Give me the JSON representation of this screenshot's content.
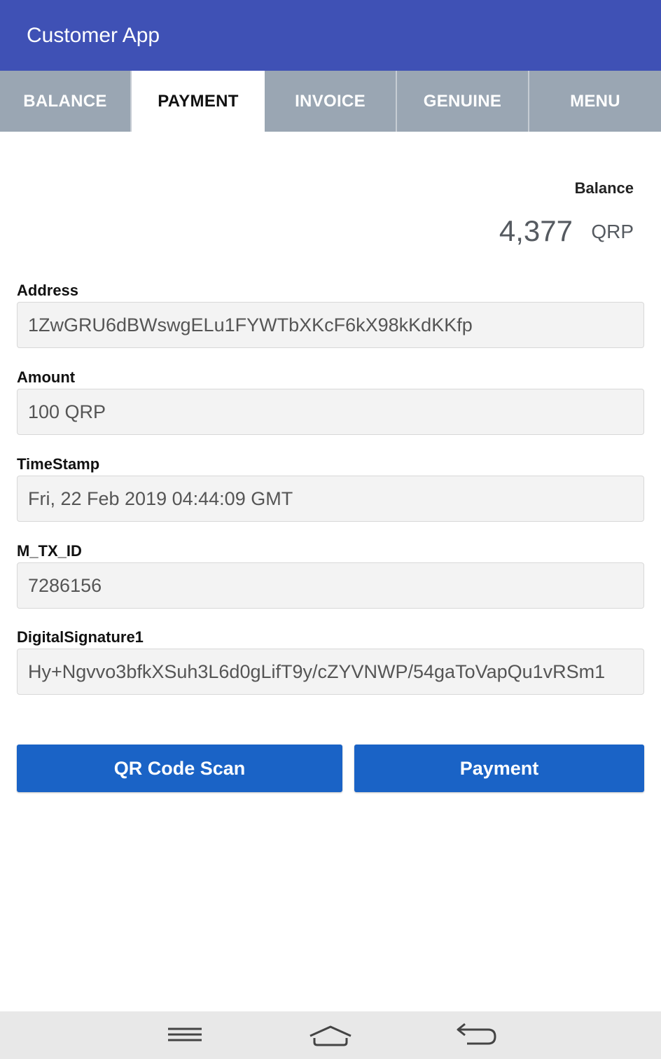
{
  "app": {
    "title": "Customer App"
  },
  "tabs": [
    {
      "label": "BALANCE",
      "active": false
    },
    {
      "label": "PAYMENT",
      "active": true
    },
    {
      "label": "INVOICE",
      "active": false
    },
    {
      "label": "GENUINE",
      "active": false
    },
    {
      "label": "MENU",
      "active": false
    }
  ],
  "balance": {
    "label": "Balance",
    "value": "4,377",
    "unit": "QRP"
  },
  "fields": {
    "address": {
      "label": "Address",
      "value": "1ZwGRU6dBWswgELu1FYWTbXKcF6kX98kKdKKfp"
    },
    "amount": {
      "label": "Amount",
      "value": "100 QRP"
    },
    "timestamp": {
      "label": "TimeStamp",
      "value": "Fri, 22 Feb 2019 04:44:09 GMT"
    },
    "m_tx_id": {
      "label": "M_TX_ID",
      "value": "7286156"
    },
    "signature": {
      "label": "DigitalSignature1",
      "value": "Hy+Ngvvo3bfkXSuh3L6d0gLifT9y/cZYVNWP/54gaToVapQu1vRSm1"
    }
  },
  "actions": {
    "scan_label": "QR Code Scan",
    "payment_label": "Payment"
  },
  "nav": {
    "icons": [
      "menu-icon",
      "home-icon",
      "back-icon"
    ]
  },
  "colors": {
    "appbar": "#3f51b5",
    "tabbar": "#9aa6b3",
    "button": "#1a63c6"
  }
}
